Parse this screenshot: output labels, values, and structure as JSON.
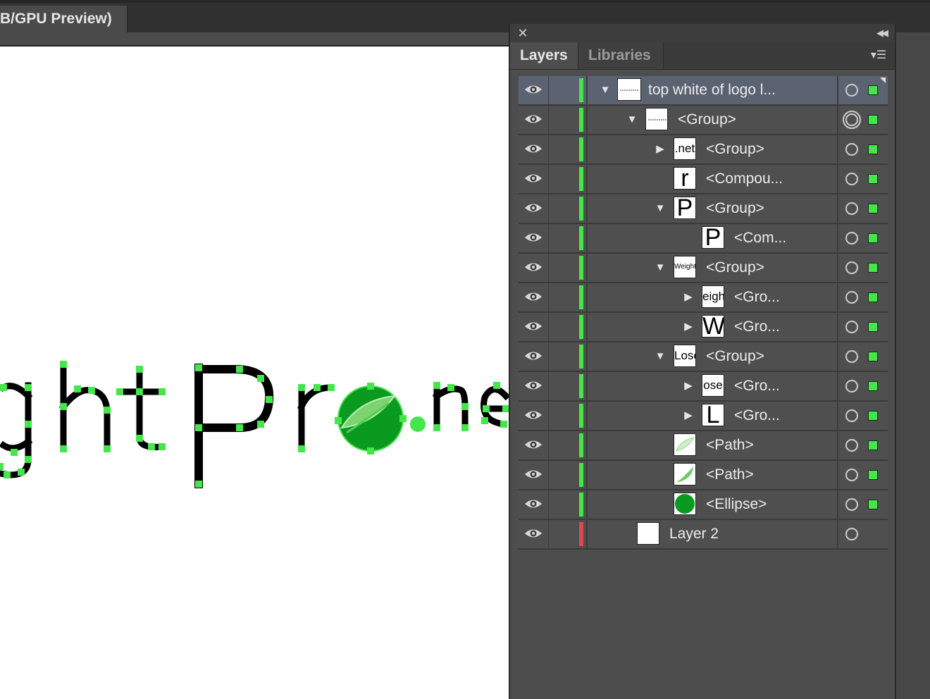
{
  "document_tab": {
    "title": "B/GPU Preview)"
  },
  "artwork_text": "ghtPro.ne",
  "panel": {
    "tabs": [
      {
        "label": "Layers"
      },
      {
        "label": "Libraries"
      }
    ],
    "close_icon": "close-icon",
    "collapse_icon": "double-chevron-left-icon",
    "menu_icon": "panel-menu-icon"
  },
  "colors": {
    "layer1_color": "#44e64b",
    "layer2_color": "#e0484f",
    "selection_row": "#5b6272",
    "ellipse_green": "#0a9a1f"
  },
  "layers": [
    {
      "name": "top white of logo l...",
      "indent": 0,
      "toggle": "expanded",
      "thumb": "mini-logo",
      "thumb_text": "",
      "target": "single",
      "selected_square": true,
      "row_selected": true,
      "color": "green"
    },
    {
      "name": "<Group>",
      "indent": 1,
      "toggle": "expanded",
      "thumb": "mini-logo",
      "thumb_text": "",
      "target": "double",
      "selected_square": true,
      "row_selected": false,
      "color": "green"
    },
    {
      "name": "<Group>",
      "indent": 2,
      "toggle": "collapsed",
      "thumb": "text",
      "thumb_text": ".net",
      "target": "single",
      "selected_square": true,
      "row_selected": false,
      "color": "green"
    },
    {
      "name": "<Compou...",
      "indent": 2,
      "toggle": "none",
      "thumb": "text-big",
      "thumb_text": "r",
      "target": "single",
      "selected_square": true,
      "row_selected": false,
      "color": "green"
    },
    {
      "name": "<Group>",
      "indent": 2,
      "toggle": "expanded",
      "thumb": "text-big",
      "thumb_text": "P",
      "target": "single",
      "selected_square": true,
      "row_selected": false,
      "color": "green"
    },
    {
      "name": "<Com...",
      "indent": 3,
      "toggle": "none",
      "thumb": "text-big",
      "thumb_text": "P",
      "target": "single",
      "selected_square": true,
      "row_selected": false,
      "color": "green"
    },
    {
      "name": "<Group>",
      "indent": 2,
      "toggle": "expanded",
      "thumb": "text-small",
      "thumb_text": "Weight",
      "target": "single",
      "selected_square": true,
      "row_selected": false,
      "color": "green"
    },
    {
      "name": "<Gro...",
      "indent": 3,
      "toggle": "collapsed",
      "thumb": "text",
      "thumb_text": "eight",
      "target": "single",
      "selected_square": true,
      "row_selected": false,
      "color": "green"
    },
    {
      "name": "<Gro...",
      "indent": 3,
      "toggle": "collapsed",
      "thumb": "text-big",
      "thumb_text": "W",
      "target": "single",
      "selected_square": true,
      "row_selected": false,
      "color": "green"
    },
    {
      "name": "<Group>",
      "indent": 2,
      "toggle": "expanded",
      "thumb": "text",
      "thumb_text": "Lose",
      "target": "single",
      "selected_square": true,
      "row_selected": false,
      "color": "green"
    },
    {
      "name": "<Gro...",
      "indent": 3,
      "toggle": "collapsed",
      "thumb": "text",
      "thumb_text": "ose",
      "target": "single",
      "selected_square": true,
      "row_selected": false,
      "color": "green"
    },
    {
      "name": "<Gro...",
      "indent": 3,
      "toggle": "collapsed",
      "thumb": "text-big",
      "thumb_text": "L",
      "target": "single",
      "selected_square": true,
      "row_selected": false,
      "color": "green"
    },
    {
      "name": "<Path>",
      "indent": 2,
      "toggle": "none",
      "thumb": "leaf1",
      "thumb_text": "",
      "target": "single",
      "selected_square": true,
      "row_selected": false,
      "color": "green"
    },
    {
      "name": "<Path>",
      "indent": 2,
      "toggle": "none",
      "thumb": "leaf2",
      "thumb_text": "",
      "target": "single",
      "selected_square": true,
      "row_selected": false,
      "color": "green"
    },
    {
      "name": "<Ellipse>",
      "indent": 2,
      "toggle": "none",
      "thumb": "ellipse",
      "thumb_text": "",
      "target": "single",
      "selected_square": true,
      "row_selected": false,
      "color": "green"
    },
    {
      "name": "Layer 2",
      "indent": 1,
      "toggle": "none",
      "thumb": "blank",
      "thumb_text": "",
      "target": "single",
      "selected_square": false,
      "row_selected": false,
      "color": "red"
    }
  ]
}
